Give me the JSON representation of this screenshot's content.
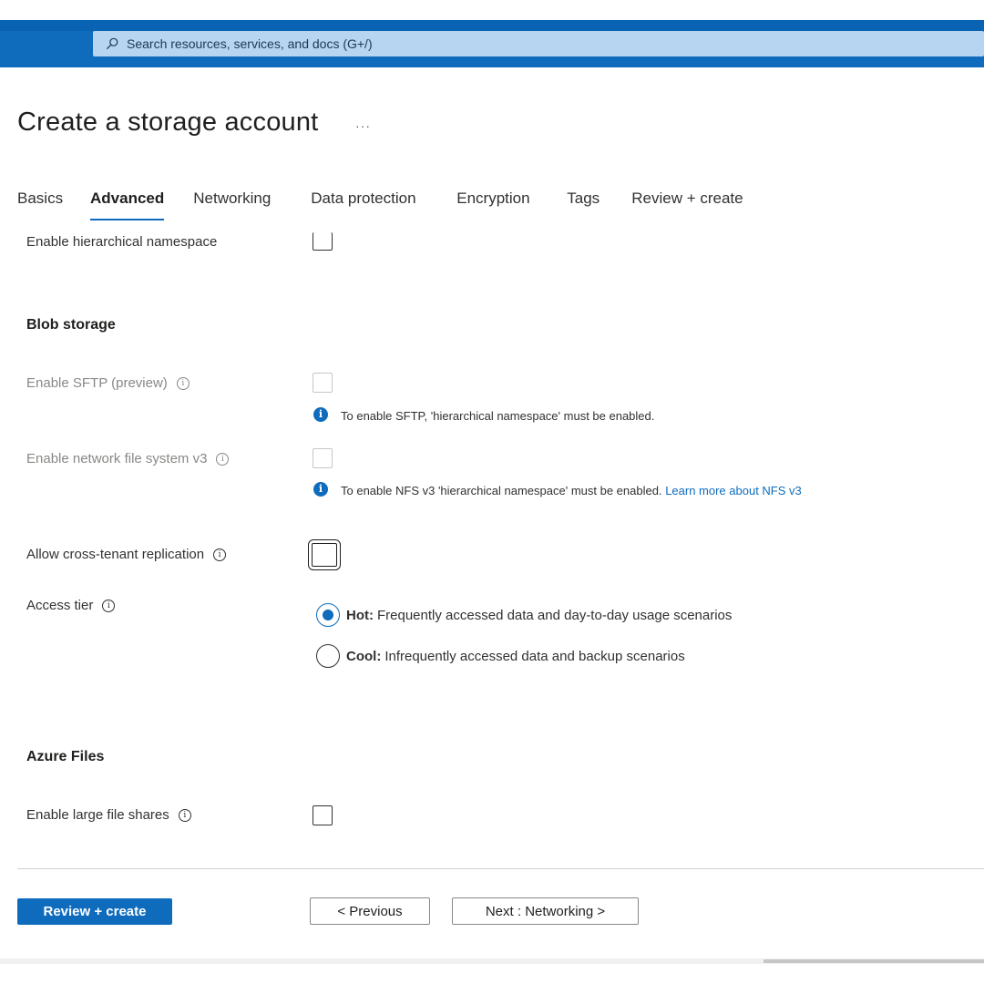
{
  "header": {
    "search_placeholder": "Search resources, services, and docs (G+/)"
  },
  "page": {
    "title": "Create a storage account",
    "more_label": "···"
  },
  "tabs": [
    {
      "label": "Basics"
    },
    {
      "label": "Advanced",
      "active": true
    },
    {
      "label": "Networking"
    },
    {
      "label": "Data protection"
    },
    {
      "label": "Encryption"
    },
    {
      "label": "Tags"
    },
    {
      "label": "Review + create"
    }
  ],
  "form": {
    "hierarchical_namespace_label": "Enable hierarchical namespace",
    "blob_storage_heading": "Blob storage",
    "sftp_label": "Enable SFTP (preview)",
    "sftp_info": "To enable SFTP, 'hierarchical namespace' must be enabled.",
    "nfs_label": "Enable network file system v3",
    "nfs_info": "To enable NFS v3 'hierarchical namespace' must be enabled.",
    "nfs_link": "Learn more about NFS v3",
    "cross_tenant_label": "Allow cross-tenant replication",
    "access_tier_label": "Access tier",
    "access_tier_options": [
      {
        "name": "Hot:",
        "desc": "Frequently accessed data and day-to-day usage scenarios",
        "selected": true
      },
      {
        "name": "Cool:",
        "desc": "Infrequently accessed data and backup scenarios",
        "selected": false
      }
    ],
    "azure_files_heading": "Azure Files",
    "large_file_shares_label": "Enable large file shares",
    "info_glyph": "i"
  },
  "footer": {
    "review_create": "Review + create",
    "previous": "< Previous",
    "next": "Next : Networking >"
  },
  "colors": {
    "accent": "#0f6cbd",
    "header_bar": "#0f6cbd",
    "search_bg": "#b7d4f0"
  }
}
